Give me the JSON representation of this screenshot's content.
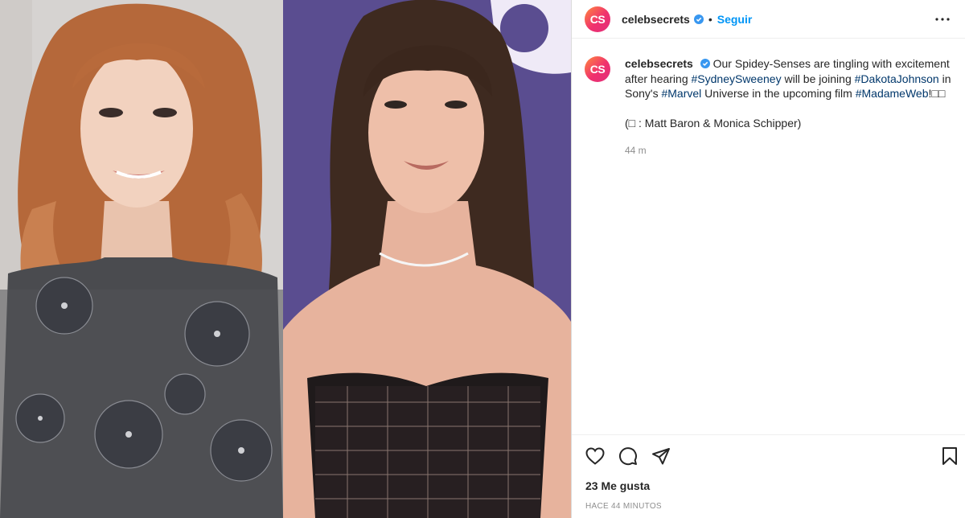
{
  "post": {
    "account": {
      "avatar_initials": "CS",
      "username": "celebsecrets",
      "verified_icon": "verified-badge-icon",
      "separator": "•",
      "follow_label": "Seguir"
    },
    "caption": {
      "username": "celebsecrets",
      "text_1": "Our Spidey-Senses are tingling with excitement after hearing ",
      "tag_1": "#SydneySweeney",
      "text_2": " will be joining ",
      "tag_2": "#DakotaJohnson",
      "text_3": " in Sony's ",
      "tag_3": "#Marvel",
      "text_4": " Universe in the upcoming film ",
      "tag_4": "#MadameWeb",
      "text_5": "!□□",
      "credit": "(□ : Matt Baron & Monica Schipper)",
      "timestamp": "44 m"
    },
    "footer": {
      "likes": "23 Me gusta",
      "posted": "HACE 44 MINUTOS"
    },
    "icons": {
      "like": "heart-icon",
      "comment": "comment-icon",
      "share": "share-icon",
      "save": "bookmark-icon",
      "more": "more-options-icon"
    },
    "colors": {
      "link": "#00376b",
      "follow": "#0095f6",
      "verified": "#3897f0",
      "avatar_gradient_start": "#ff8a3d",
      "avatar_gradient_end": "#e0307a"
    }
  }
}
